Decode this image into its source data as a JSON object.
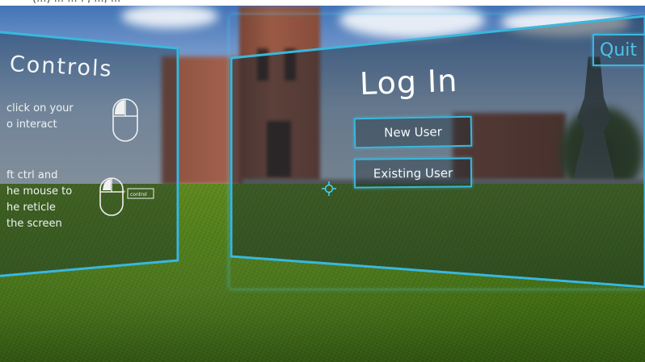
{
  "top_caption_fragment": "(...) ... ... . , ..., ...",
  "colors": {
    "accent": "#35b6dd",
    "panel_bg": "rgba(18,34,44,0.4)",
    "text": "#ffffff"
  },
  "controls_panel": {
    "title": "Controls",
    "instruction_1": "click on your\no interact",
    "instruction_2": "ft ctrl and\nhe mouse to\nhe reticle\nthe screen",
    "key_label": "control",
    "icons": [
      "mouse-left-click-icon",
      "mouse-move-icon"
    ]
  },
  "login_panel": {
    "title": "Log In",
    "buttons": {
      "new_user": "New User",
      "existing_user": "Existing User"
    },
    "quit": "Quit"
  },
  "reticle": {
    "icon": "crosshair-reticle-icon"
  }
}
